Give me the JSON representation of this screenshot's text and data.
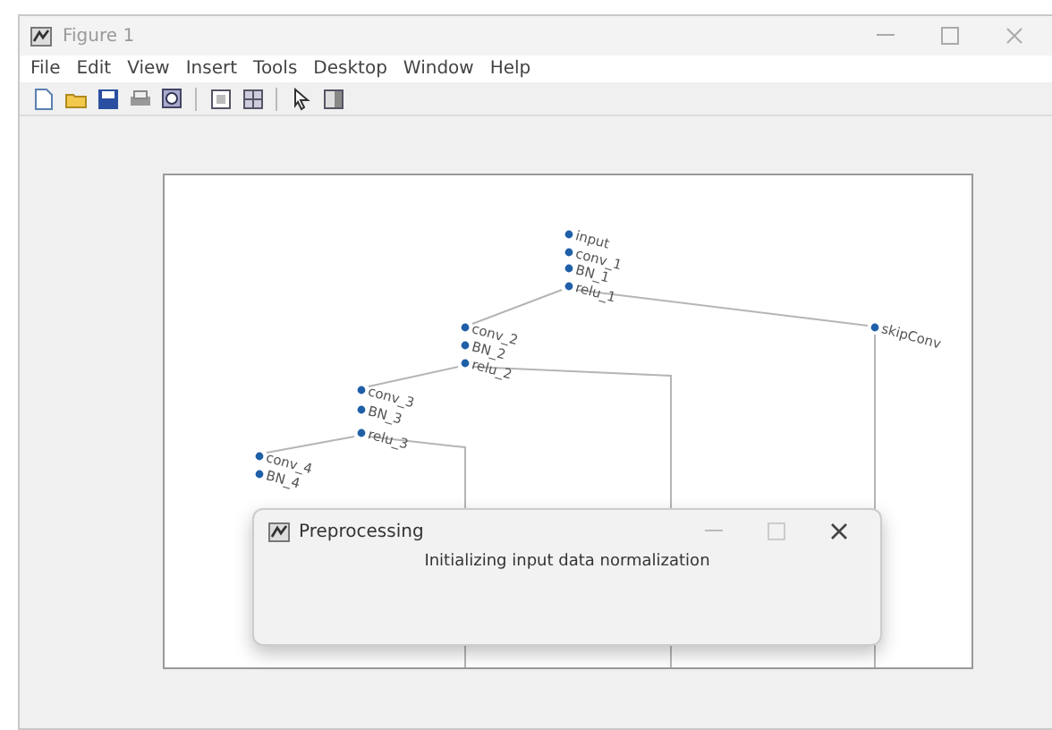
{
  "window": {
    "title": "Figure 1"
  },
  "menu": [
    "File",
    "Edit",
    "View",
    "Insert",
    "Tools",
    "Desktop",
    "Window",
    "Help"
  ],
  "toolbar": [
    {
      "kind": "new"
    },
    {
      "kind": "open"
    },
    {
      "kind": "save"
    },
    {
      "kind": "print"
    },
    {
      "kind": "zoom"
    },
    {
      "kind": "separator"
    },
    {
      "kind": "frame"
    },
    {
      "kind": "tile"
    },
    {
      "kind": "separator"
    },
    {
      "kind": "pointer"
    },
    {
      "kind": "panel"
    }
  ],
  "graph": {
    "nodes": [
      {
        "label": "input"
      },
      {
        "label": "conv_1"
      },
      {
        "label": "BN_1"
      },
      {
        "label": "relu_1"
      },
      {
        "label": "skipConv"
      },
      {
        "label": "conv_2"
      },
      {
        "label": "BN_2"
      },
      {
        "label": "relu_2"
      },
      {
        "label": "conv_3"
      },
      {
        "label": "BN_3"
      },
      {
        "label": "relu_3"
      },
      {
        "label": "conv_4"
      },
      {
        "label": "BN_4"
      }
    ]
  },
  "dialog": {
    "title": "Preprocessing",
    "message": "Initializing input data normalization"
  }
}
